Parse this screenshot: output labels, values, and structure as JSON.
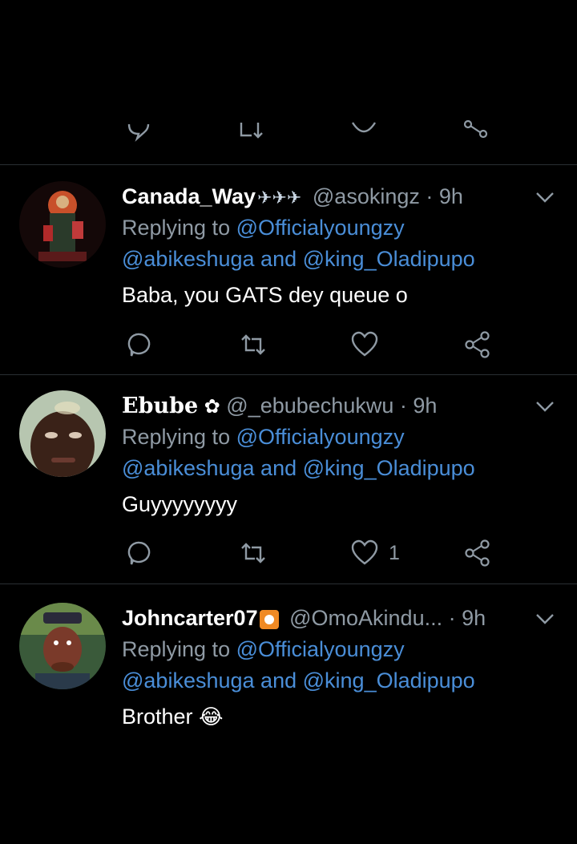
{
  "top_actions": {},
  "tweets": [
    {
      "name": "Canada_Way",
      "name_suffix_emoji": "✈✈✈",
      "handle": "@asokingz",
      "sep": "·",
      "time": "9h",
      "replying_prefix": "Replying to",
      "mention_1": "@Officialyoungzy",
      "mention_2": "@abikeshuga",
      "and": "and",
      "mention_3": "@king_Oladipupo",
      "text": "Baba, you GATS dey queue o",
      "like_count": ""
    },
    {
      "name": "Ebube",
      "name_badge": "✿",
      "handle": "@_ebubechukwu",
      "sep": "·",
      "time": "9h",
      "replying_prefix": "Replying to",
      "mention_1": "@Officialyoungzy",
      "mention_2": "@abikeshuga",
      "and": "and",
      "mention_3": "@king_Oladipupo",
      "text": "Guyyyyyyyy",
      "like_count": "1"
    },
    {
      "name": "Johncarter07",
      "name_badge": "◘",
      "handle": "@OmoAkindu...",
      "sep": "·",
      "time": "9h",
      "replying_prefix": "Replying to",
      "mention_1": "@Officialyoungzy",
      "mention_2": "@abikeshuga",
      "and": "and",
      "mention_3": "@king_Oladipupo",
      "text": "Brother",
      "text_emoji": "😂"
    }
  ],
  "icons": {
    "reply": "reply-icon",
    "retweet": "retweet-icon",
    "like": "heart-icon",
    "share": "share-icon",
    "more": "chevron-down-icon"
  },
  "colors": {
    "background": "#000000",
    "muted": "#8f9aa4",
    "mention": "#4a8ed8",
    "divider": "#2a2f33"
  }
}
